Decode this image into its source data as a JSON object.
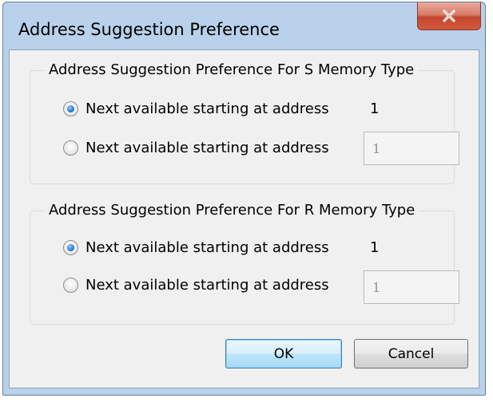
{
  "window": {
    "title": "Address Suggestion Preference",
    "close_icon": "close-icon"
  },
  "s_group": {
    "legend": "Address Suggestion Preference For S Memory Type",
    "option1": {
      "label": "Next available starting at address",
      "value": "1",
      "checked": true
    },
    "option2": {
      "label": "Next available starting at address",
      "input_value": "1",
      "checked": false
    }
  },
  "r_group": {
    "legend": "Address Suggestion Preference For R Memory Type",
    "option1": {
      "label": "Next available starting at address",
      "value": "1",
      "checked": true
    },
    "option2": {
      "label": "Next available starting at address",
      "input_value": "1",
      "checked": false
    }
  },
  "buttons": {
    "ok": "OK",
    "cancel": "Cancel"
  },
  "colors": {
    "frame": "#b9d1ea",
    "client": "#f0f0f0",
    "close_button": "#c4462f",
    "radio_selected": "#2a7fd4"
  }
}
